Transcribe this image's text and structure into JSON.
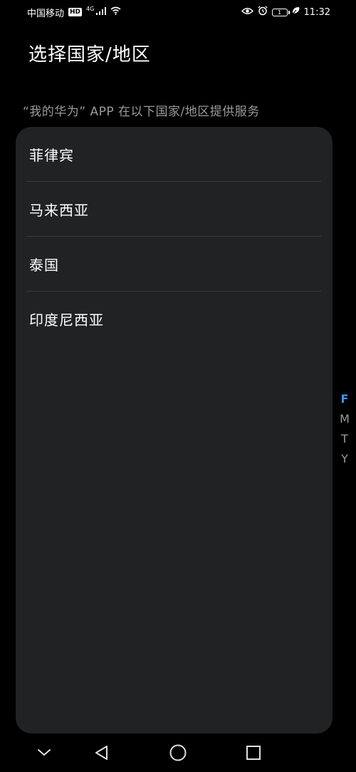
{
  "status_bar": {
    "carrier": "中国移动",
    "hd": "HD",
    "network": "4G",
    "battery_level": "1",
    "time": "11:32"
  },
  "page": {
    "title": "选择国家/地区",
    "subtitle": "“我的华为” APP 在以下国家/地区提供服务"
  },
  "countries": [
    {
      "name": "菲律宾"
    },
    {
      "name": "马来西亚"
    },
    {
      "name": "泰国"
    },
    {
      "name": "印度尼西亚"
    }
  ],
  "alpha_index": [
    "F",
    "M",
    "T",
    "Y"
  ],
  "colors": {
    "background": "#000000",
    "card": "#202224",
    "divider": "#3a3c3e",
    "accent": "#4a8ff0",
    "muted_text": "#9a9a9a"
  },
  "nav": {
    "icons": [
      "chevron-down-icon",
      "back-triangle-icon",
      "home-circle-icon",
      "recents-square-icon"
    ]
  }
}
